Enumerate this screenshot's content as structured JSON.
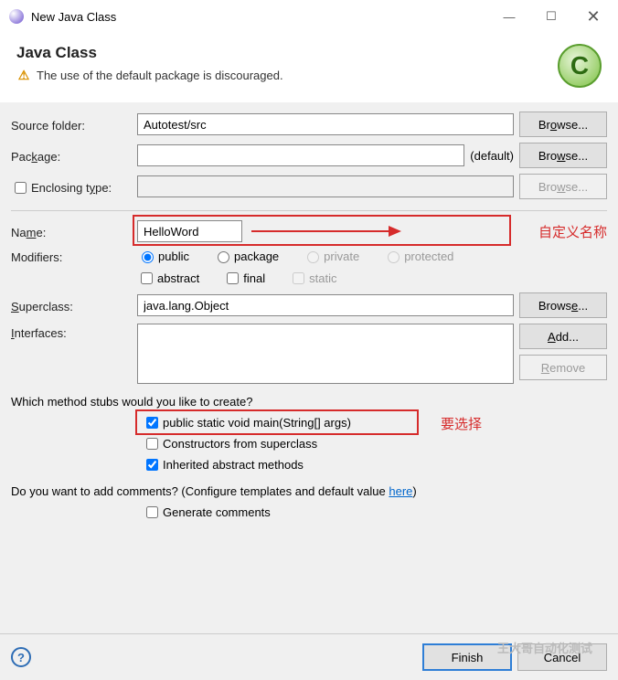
{
  "title": "New Java Class",
  "header": {
    "title": "Java Class",
    "warning": "The use of the default package is discouraged."
  },
  "labels": {
    "sourceFolder": "Source folder:",
    "package": "Package:",
    "enclosingType": "Enclosing type:",
    "name": "Name:",
    "modifiers": "Modifiers:",
    "superclass": "Superclass:",
    "interfaces": "Interfaces:",
    "defaultPkg": "(default)"
  },
  "values": {
    "sourceFolder": "Autotest/src",
    "package": "",
    "enclosingType": "",
    "name": "HelloWord",
    "superclass": "java.lang.Object"
  },
  "buttons": {
    "browse": "Browse...",
    "add": "Add...",
    "remove": "Remove",
    "finish": "Finish",
    "cancel": "Cancel"
  },
  "modifiers": {
    "public": "public",
    "package": "package",
    "private": "private",
    "protected": "protected",
    "abstract": "abstract",
    "final": "final",
    "static": "static"
  },
  "stubs": {
    "question": "Which method stubs would you like to create?",
    "main": "public static void main(String[] args)",
    "constructors": "Constructors from superclass",
    "inherited": "Inherited abstract methods"
  },
  "comments": {
    "question_pre": "Do you want to add comments? (Configure templates and default value ",
    "here": "here",
    "question_post": ")",
    "generate": "Generate comments"
  },
  "annotations": {
    "nameNote": "自定义名称",
    "stubNote": "要选择"
  },
  "watermark": "王大哥自动化测试"
}
